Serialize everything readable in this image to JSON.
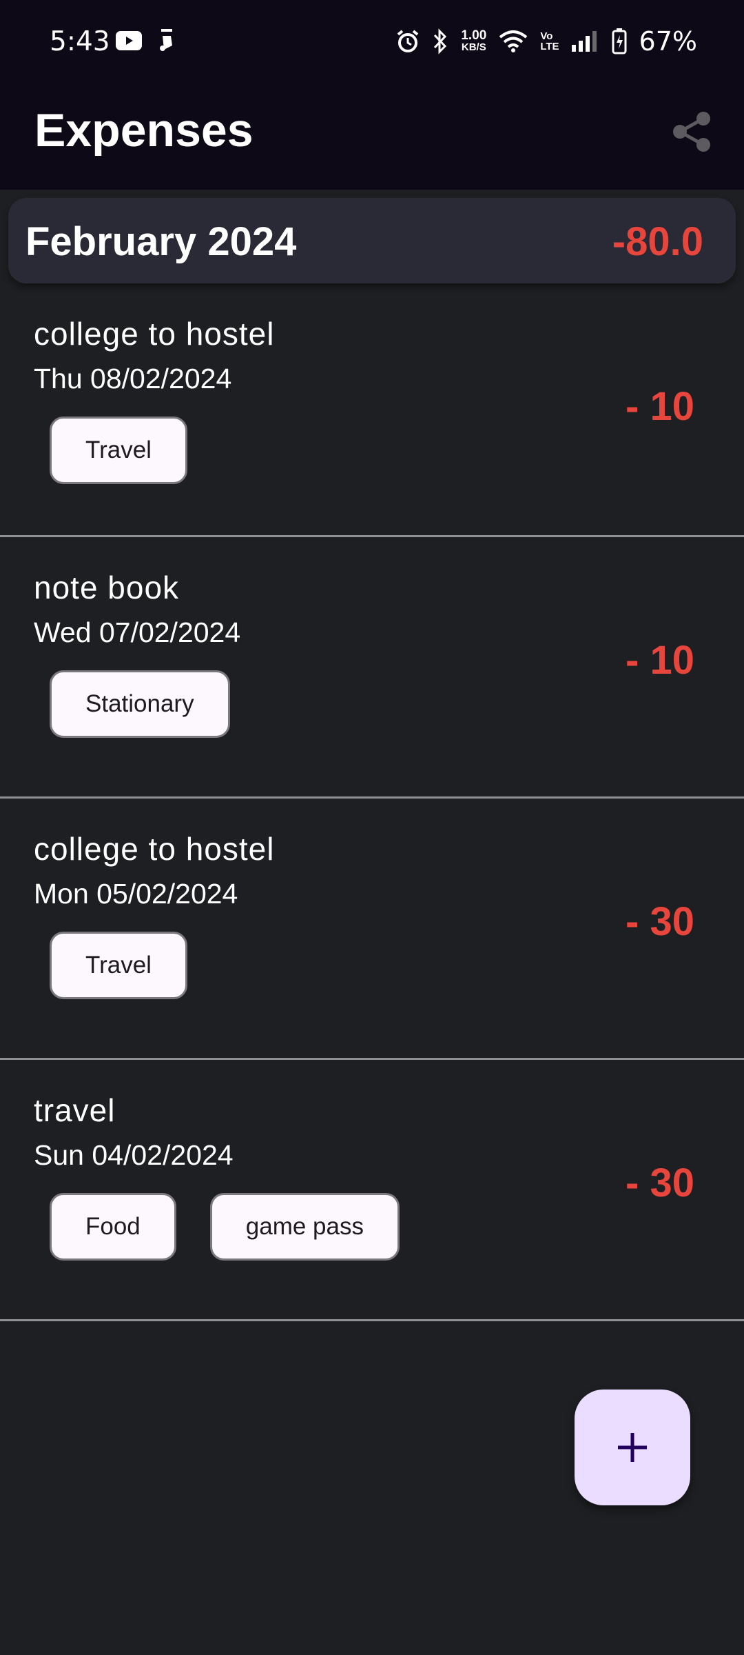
{
  "status_bar": {
    "time": "5:43",
    "net_speed_value": "1.00",
    "net_speed_unit": "KB/S",
    "volte_top": "Vo",
    "volte_bottom": "LTE",
    "battery": "67%",
    "icons": [
      "youtube-icon",
      "notification-icon",
      "alarm-icon",
      "bluetooth-icon",
      "wifi-icon",
      "signal-icon",
      "battery-icon"
    ]
  },
  "app_bar": {
    "title": "Expenses",
    "share_icon": "share-icon"
  },
  "month": {
    "label": "February 2024",
    "total": "-80.0"
  },
  "expenses": [
    {
      "title": "college to hostel",
      "date": "Thu 08/02/2024",
      "tags": [
        "Travel"
      ],
      "amount": "- 10"
    },
    {
      "title": "note book",
      "date": "Wed 07/02/2024",
      "tags": [
        "Stationary"
      ],
      "amount": "- 10"
    },
    {
      "title": "college to hostel",
      "date": "Mon 05/02/2024",
      "tags": [
        "Travel"
      ],
      "amount": "- 30"
    },
    {
      "title": "travel",
      "date": "Sun 04/02/2024",
      "tags": [
        "Food",
        "game pass"
      ],
      "amount": "- 30"
    }
  ],
  "fab": {
    "icon": "plus-icon",
    "symbol": "+"
  },
  "colors": {
    "background": "#1d1f22",
    "app_bar": "#0e0916",
    "negative_amount": "#e8453c",
    "fab": "#eaddff",
    "tag_bg": "#fdf8fd"
  }
}
